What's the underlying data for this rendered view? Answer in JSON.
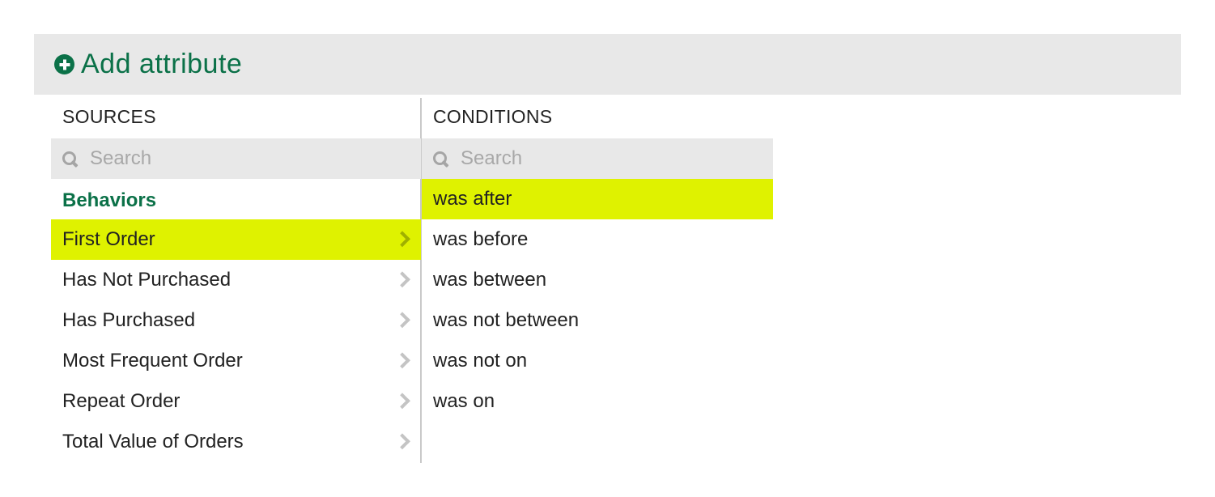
{
  "header": {
    "title": "Add attribute"
  },
  "sources": {
    "heading": "SOURCES",
    "search_placeholder": "Search",
    "group_label": "Behaviors",
    "items": [
      {
        "label": "First Order",
        "selected": true
      },
      {
        "label": "Has Not Purchased",
        "selected": false
      },
      {
        "label": "Has Purchased",
        "selected": false
      },
      {
        "label": "Most Frequent Order",
        "selected": false
      },
      {
        "label": "Repeat Order",
        "selected": false
      },
      {
        "label": "Total Value of Orders",
        "selected": false
      }
    ]
  },
  "conditions": {
    "heading": "CONDITIONS",
    "search_placeholder": "Search",
    "items": [
      {
        "label": "was after",
        "selected": true
      },
      {
        "label": "was before",
        "selected": false
      },
      {
        "label": "was between",
        "selected": false
      },
      {
        "label": "was not between",
        "selected": false
      },
      {
        "label": "was not on",
        "selected": false
      },
      {
        "label": "was on",
        "selected": false
      }
    ]
  },
  "colors": {
    "accent_green": "#0b7148",
    "selection_highlight": "#dff200",
    "panel_gray": "#e8e8e8"
  },
  "icons": {
    "add": "plus-circle-icon",
    "search": "search-icon",
    "submenu": "chevron-right-icon"
  }
}
